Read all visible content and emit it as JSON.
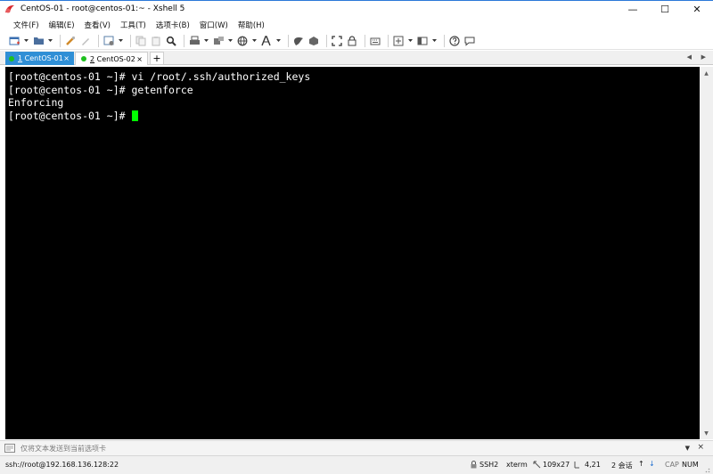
{
  "window": {
    "title": "CentOS-01 - root@centos-01:~ - Xshell 5",
    "app_icon": "xshell-logo-icon",
    "controls": {
      "minimize": "—",
      "maximize": "☐",
      "close": "✕"
    }
  },
  "menu": {
    "items": [
      "文件(F)",
      "编辑(E)",
      "查看(V)",
      "工具(T)",
      "选项卡(B)",
      "窗口(W)",
      "帮助(H)"
    ]
  },
  "toolbar": {
    "icons": [
      "new-session-icon",
      "open-folder-icon",
      "link-icon",
      "edit-icon",
      "properties-icon",
      "copy-icon",
      "paste-icon",
      "find-icon",
      "print-icon",
      "transfer-icon",
      "globe-icon",
      "font-icon",
      "xftp-icon",
      "xmanager-icon",
      "fullscreen-icon",
      "lock-icon",
      "keyboard-icon",
      "compose-icon",
      "layout-icon",
      "help-icon",
      "chat-icon"
    ]
  },
  "tabs": [
    {
      "number": "1",
      "label": "CentOS-01",
      "active": true,
      "status_color": "#1ec01e"
    },
    {
      "number": "2",
      "label": "CentOS-02",
      "active": false,
      "status_color": "#1ec01e"
    }
  ],
  "tab_close": "×",
  "tab_add": "+",
  "terminal": {
    "lines": [
      "[root@centos-01 ~]# vi /root/.ssh/authorized_keys",
      "[root@centos-01 ~]# getenforce",
      "Enforcing",
      "[root@centos-01 ~]# "
    ],
    "background": "#000000",
    "foreground": "#ffffff",
    "cursor_color": "#00ff00"
  },
  "compose_bar": {
    "placeholder": "仅将文本发送到当前选项卡"
  },
  "statusbar": {
    "connection": "ssh://root@192.168.136.128:22",
    "protocol": "SSH2",
    "terminal_type": "xterm",
    "size": "109x27",
    "cursor_pos": "4,21",
    "sessions": "2 会话",
    "cap": "CAP",
    "num": "NUM"
  },
  "colors": {
    "active_tab": "#2f8fd6",
    "title_border": "#2b79d8"
  }
}
